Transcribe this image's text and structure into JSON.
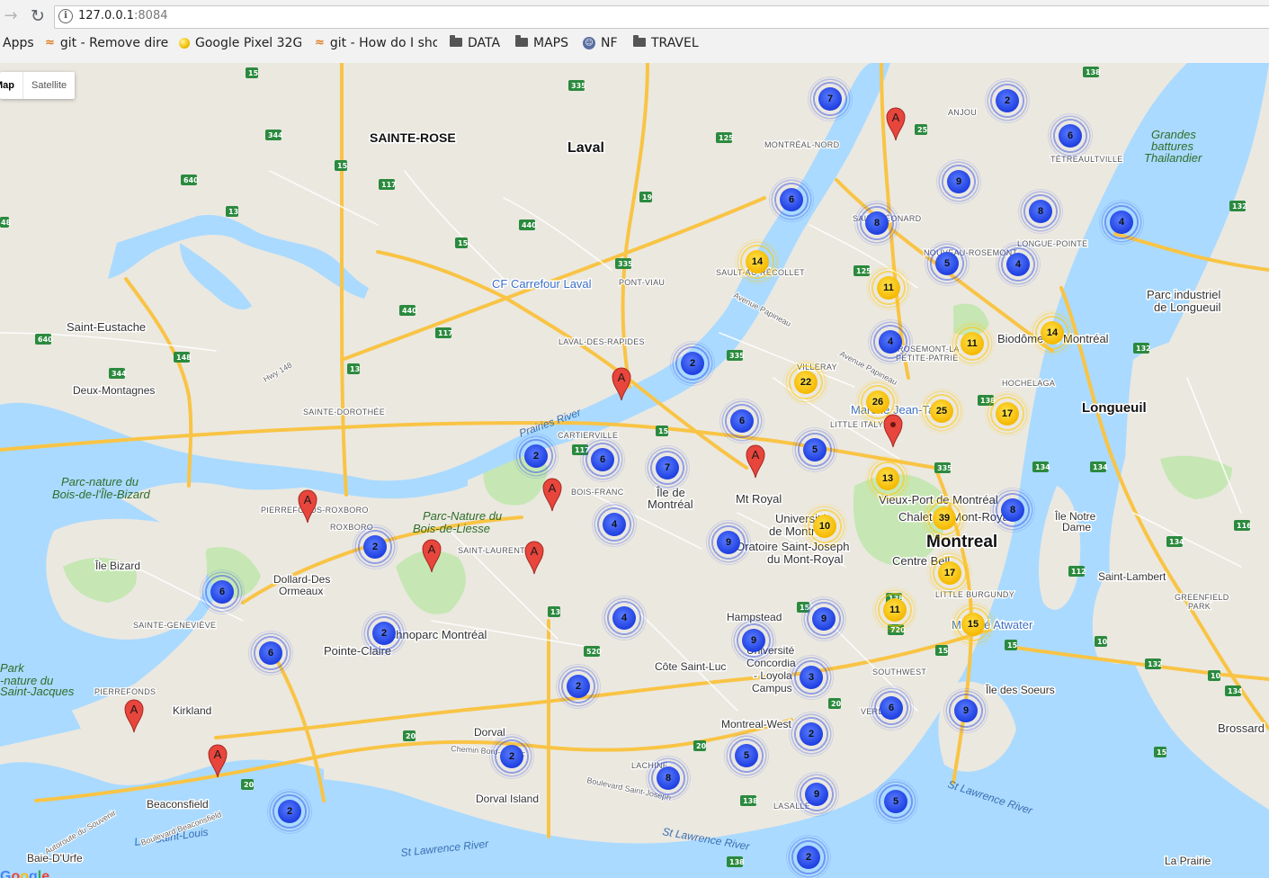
{
  "browser": {
    "url_host": "127.0.0.1",
    "url_port": ":8084",
    "bookmarks": [
      {
        "label": "Apps",
        "icon": "apps-grid-icon"
      },
      {
        "label": "git - Remove dire",
        "icon": "stackoverflow-icon"
      },
      {
        "label": "Google Pixel 32G",
        "icon": "google-pixel-icon"
      },
      {
        "label": "git - How do I sho",
        "icon": "stackoverflow-icon"
      },
      {
        "label": "DATA",
        "icon": "folder-icon"
      },
      {
        "label": "MAPS",
        "icon": "folder-icon"
      },
      {
        "label": "NF",
        "icon": "nf-icon"
      },
      {
        "label": "TRAVEL",
        "icon": "folder-icon"
      }
    ]
  },
  "map_type": {
    "map_label": "Map",
    "satellite_label": "Satellite"
  },
  "colors": {
    "cluster_small": "#2447e6",
    "cluster_large": "#f7c000",
    "marker": "#e8453c",
    "water": "#aadaff",
    "highway": "#f9c445",
    "park": "#c6e7b4"
  },
  "places": {
    "sainte_rose": "SAINTE-ROSE",
    "laval": "Laval",
    "cf_carrefour": "CF Carrefour Laval",
    "pont_viau": "PONT-VIAU",
    "laval_des_rapides": "LAVAL-DES-RAPIDES",
    "saint_eustache": "Saint-Eustache",
    "deux_montagnes": "Deux-Montagnes",
    "sainte_dorothee": "SAINTE-DOROTHÉE",
    "cartierville": "CARTIERVILLE",
    "bois_franc": "BOIS-FRANC",
    "ile_de_montreal_1": "Île de",
    "ile_de_montreal_2": "Montréal",
    "mt_royal": "Mt Royal",
    "pierrefonds_roxboro": "PIERREFONDS-ROXBORO",
    "roxboro": "ROXBORO",
    "ile_bizard": "Île Bizard",
    "parc_bizard_1": "Parc-nature du",
    "parc_bizard_2": "Bois-de-l'Île-Bizard",
    "parc_liesse_1": "Parc-Nature du",
    "parc_liesse_2": "Bois-de-Liesse",
    "saint_laurent": "SAINT-LAURENT",
    "dollard_1": "Dollard-Des",
    "dollard_2": "Ormeaux",
    "sainte_genevieve": "SAINTE-GENEVIÈVE",
    "pierrefonds": "PIERREFONDS",
    "pointe_claire": "Pointe-Claire",
    "technoparc": "Technoparc Montréal",
    "kirkland": "Kirkland",
    "park_1": "Park",
    "park_2": "-nature du",
    "park_3": "Saint-Jacques",
    "cote_saint_luc": "Côte Saint-Luc",
    "hampstead": "Hampstead",
    "concordia_1": "Université",
    "concordia_2": "Concordia",
    "concordia_3": "- Loyola",
    "concordia_4": "Campus",
    "montreal_west": "Montreal-West",
    "dorval": "Dorval",
    "dorval_island": "Dorval Island",
    "lachine": "LACHINE",
    "lasalle": "LASALLE",
    "beaconsfield": "Beaconsfield",
    "baie_durfe": "Baie-D'Urfe",
    "montreal": "Montreal",
    "vieux_port": "Vieux-Port de Montréal",
    "chalet": "Chalet du Mont-Royal",
    "universite_1": "Université",
    "universite_2": "de Montréal",
    "oratoire_1": "Oratoire Saint-Joseph",
    "oratoire_2": "du Mont-Royal",
    "centre_bell": "Centre Bell",
    "little_burgundy": "LITTLE BURGUNDY",
    "atwater": "Marché Atwater",
    "southwest": "SOUTHWEST",
    "ile_des_soeurs": "Île des Soeurs",
    "verdun": "VERDUN",
    "longueuil": "Longueuil",
    "parc_longueuil_1": "Parc industriel",
    "parc_longueuil_2": "de Longueuil",
    "ile_notre_dame_1": "Île Notre",
    "ile_notre_dame_2": "Dame",
    "saint_lambert": "Saint-Lambert",
    "greenfield_1": "GREENFIELD",
    "greenfield_2": "PARK",
    "brossard": "Brossard",
    "la_prairie": "La Prairie",
    "grandes_1": "Grandes",
    "grandes_2": "battures",
    "grandes_3": "Thailandier",
    "tetreaultville": "TÉTREAULTVILLE",
    "anjou": "ANJOU",
    "montreal_nord": "MONTRÉAL-NORD",
    "saint_leonard": "SAINT-LÉONARD",
    "nouveau_rosemont": "NOUVEAU-ROSEMONT",
    "longue_pointe": "LONGUE-POINTE",
    "sault": "SAULT-AU-RÉCOLLET",
    "villeray": "VILLERAY",
    "rosemont_1": "ROSEMONT-LA",
    "rosemont_2": "PETITE-PATRIE",
    "hochelaga": "HOCHELAGA",
    "little_italy": "LITTLE ITALY",
    "marche_jean_talon": "Marché Jean-Talon",
    "biodome": "Biodôme de Montréal",
    "saint_lawrence_1": "St Lawrence River",
    "saint_lawrence_2": "St Lawrence River",
    "saint_lawrence_3": "St Lawrence River",
    "prairies_river": "Prairies River",
    "lac_saint_louis": "Lac Saint-Louis"
  },
  "clusters": [
    {
      "count": "7",
      "color": "blue"
    },
    {
      "count": "2",
      "color": "blue"
    },
    {
      "count": "6",
      "color": "blue"
    },
    {
      "count": "9",
      "color": "blue"
    },
    {
      "count": "6",
      "color": "blue"
    },
    {
      "count": "8",
      "color": "blue"
    },
    {
      "count": "8",
      "color": "blue"
    },
    {
      "count": "4",
      "color": "blue"
    },
    {
      "count": "14",
      "color": "yellow"
    },
    {
      "count": "5",
      "color": "blue"
    },
    {
      "count": "4",
      "color": "blue"
    },
    {
      "count": "11",
      "color": "yellow"
    },
    {
      "count": "4",
      "color": "blue"
    },
    {
      "count": "11",
      "color": "yellow"
    },
    {
      "count": "14",
      "color": "yellow"
    },
    {
      "count": "2",
      "color": "blue"
    },
    {
      "count": "22",
      "color": "yellow"
    },
    {
      "count": "26",
      "color": "yellow"
    },
    {
      "count": "25",
      "color": "yellow"
    },
    {
      "count": "17",
      "color": "yellow"
    },
    {
      "count": "6",
      "color": "blue"
    },
    {
      "count": "5",
      "color": "blue"
    },
    {
      "count": "13",
      "color": "yellow"
    },
    {
      "count": "2",
      "color": "blue"
    },
    {
      "count": "6",
      "color": "blue"
    },
    {
      "count": "7",
      "color": "blue"
    },
    {
      "count": "8",
      "color": "blue"
    },
    {
      "count": "39",
      "color": "yellow"
    },
    {
      "count": "10",
      "color": "yellow"
    },
    {
      "count": "4",
      "color": "blue"
    },
    {
      "count": "9",
      "color": "blue"
    },
    {
      "count": "2",
      "color": "blue"
    },
    {
      "count": "17",
      "color": "yellow"
    },
    {
      "count": "6",
      "color": "blue"
    },
    {
      "count": "4",
      "color": "blue"
    },
    {
      "count": "9",
      "color": "blue"
    },
    {
      "count": "11",
      "color": "yellow"
    },
    {
      "count": "2",
      "color": "blue"
    },
    {
      "count": "15",
      "color": "yellow"
    },
    {
      "count": "6",
      "color": "blue"
    },
    {
      "count": "9",
      "color": "blue"
    },
    {
      "count": "3",
      "color": "blue"
    },
    {
      "count": "2",
      "color": "blue"
    },
    {
      "count": "6",
      "color": "blue"
    },
    {
      "count": "9",
      "color": "blue"
    },
    {
      "count": "2",
      "color": "blue"
    },
    {
      "count": "5",
      "color": "blue"
    },
    {
      "count": "2",
      "color": "blue"
    },
    {
      "count": "8",
      "color": "blue"
    },
    {
      "count": "9",
      "color": "blue"
    },
    {
      "count": "2",
      "color": "blue"
    },
    {
      "count": "5",
      "color": "blue"
    },
    {
      "count": "2",
      "color": "blue"
    }
  ],
  "markers": [
    {
      "label": "A"
    },
    {
      "label": "A"
    },
    {
      "label": ""
    },
    {
      "label": "A"
    },
    {
      "label": "A"
    },
    {
      "label": "A"
    },
    {
      "label": "A"
    },
    {
      "label": "A"
    },
    {
      "label": "A"
    },
    {
      "label": "A"
    }
  ],
  "google_logo": "Google"
}
